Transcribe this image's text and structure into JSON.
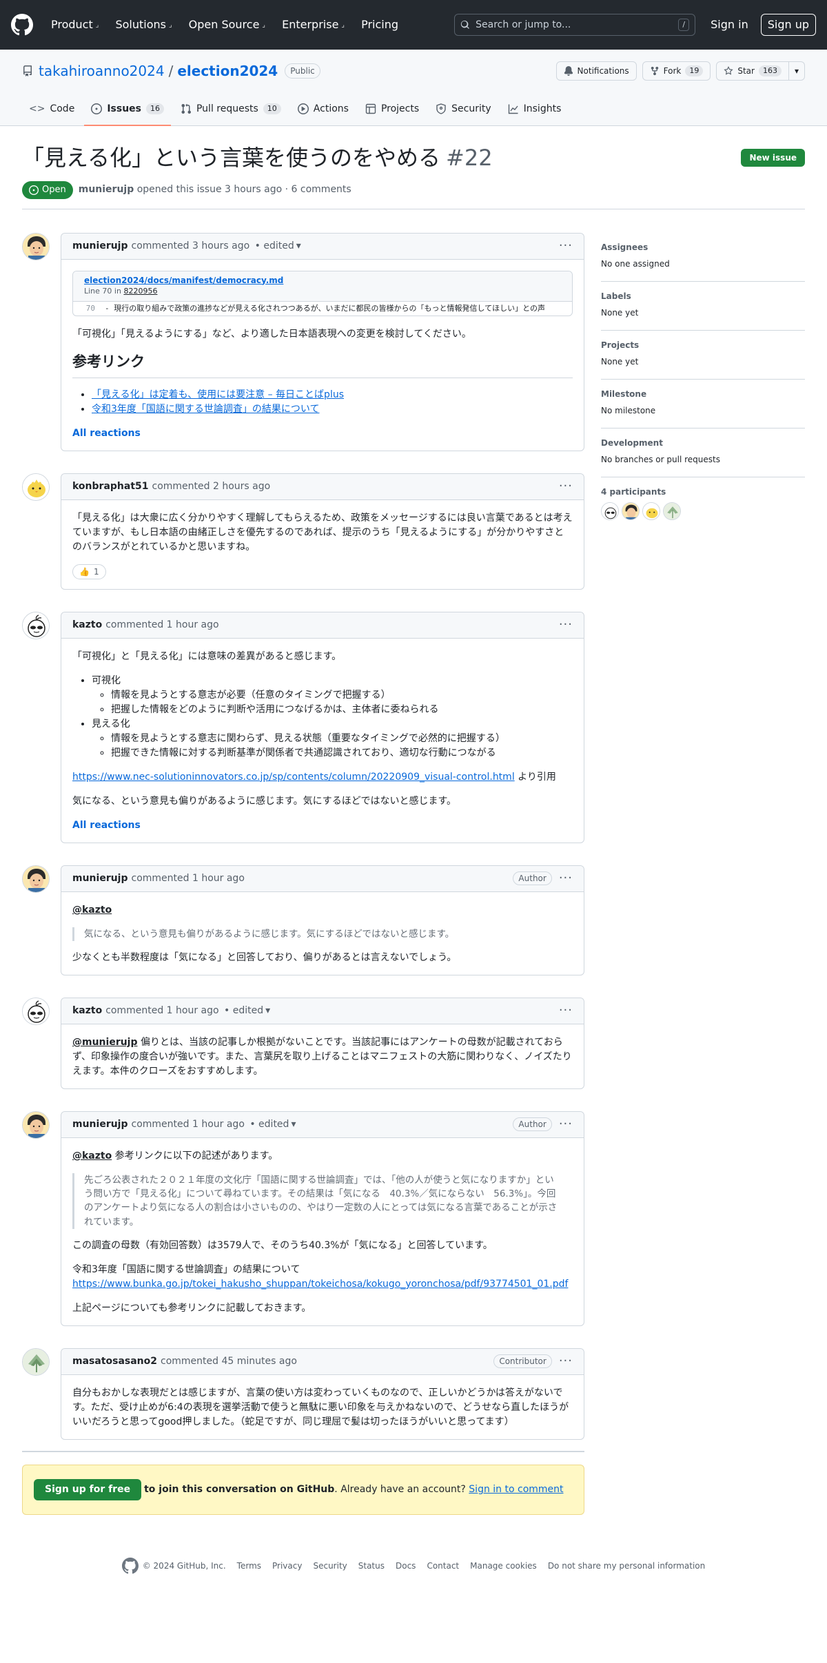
{
  "header": {
    "nav": [
      "Product",
      "Solutions",
      "Open Source",
      "Enterprise",
      "Pricing"
    ],
    "search_placeholder": "Search or jump to...",
    "search_kbd": "/",
    "signin": "Sign in",
    "signup": "Sign up"
  },
  "repo": {
    "owner": "takahiroanno2024",
    "name": "election2024",
    "visibility": "Public",
    "notifications": "Notifications",
    "fork_label": "Fork",
    "fork_count": "19",
    "star_label": "Star",
    "star_count": "163",
    "tabs": [
      {
        "label": "Code",
        "count": ""
      },
      {
        "label": "Issues",
        "count": "16"
      },
      {
        "label": "Pull requests",
        "count": "10"
      },
      {
        "label": "Actions",
        "count": ""
      },
      {
        "label": "Projects",
        "count": ""
      },
      {
        "label": "Security",
        "count": ""
      },
      {
        "label": "Insights",
        "count": ""
      }
    ]
  },
  "issue": {
    "title": "「見える化」という言葉を使うのをやめる",
    "number": "#22",
    "new_issue": "New issue",
    "state": "Open",
    "author": "munierujp",
    "meta": "opened this issue 3 hours ago · 6 comments"
  },
  "comments": {
    "c1": {
      "author": "munierujp",
      "time": "commented 3 hours ago",
      "edited": "• edited",
      "permalink_file": "election2024/docs/manifest/democracy.md",
      "permalink_line": "Line 70 in",
      "permalink_commit": "8220956",
      "code_line_no": "70",
      "code_text": "- 現行の取り組みで政策の進捗などが見える化されつつあるが、いまだに都民の皆様からの「もっと情報発信してほしい」との声",
      "text": "「可視化」「見えるようにする」など、より適した日本語表現への変更を検討してください。",
      "heading": "参考リンク",
      "link1": "「見える化」は定着も、使用には要注意 – 毎日ことばplus",
      "link2": "令和3年度「国語に関する世論調査」の結果について",
      "reactions": "All reactions"
    },
    "c2": {
      "author": "konbraphat51",
      "time": "commented 2 hours ago",
      "text": "「見える化」は大衆に広く分かりやすく理解してもらえるため、政策をメッセージするには良い言葉であるとは考えていますが、もし日本語の由緒正しさを優先するのであれば、提示のうち「見えるようにする」が分かりやすさとのバランスがとれているかと思いますね。",
      "reaction_count": "1"
    },
    "c3": {
      "author": "kazto",
      "time": "commented 1 hour ago",
      "intro": "「可視化」と「見える化」には意味の差異があると感じます。",
      "item1": "可視化",
      "item1a": "情報を見ようとする意志が必要（任意のタイミングで把握する）",
      "item1b": "把握した情報をどのように判断や活用につなげるかは、主体者に委ねられる",
      "item2": "見える化",
      "item2a": "情報を見ようとする意志に関わらず、見える状態（重要なタイミングで必然的に把握する）",
      "item2b": "把握できた情報に対する判断基準が関係者で共通認識されており、適切な行動につながる",
      "link": "https://www.nec-solutioninnovators.co.jp/sp/contents/column/20220909_visual-control.html",
      "link_suffix": "より引用",
      "closing": "気になる、という意見も偏りがあるように感じます。気にするほどではないと感じます。",
      "reactions": "All reactions"
    },
    "c4": {
      "author": "munierujp",
      "time": "commented 1 hour ago",
      "role": "Author",
      "mention": "@kazto",
      "quote": "気になる、という意見も偏りがあるように感じます。気にするほどではないと感じます。",
      "text": "少なくとも半数程度は「気になる」と回答しており、偏りがあるとは言えないでしょう。"
    },
    "c5": {
      "author": "kazto",
      "time": "commented 1 hour ago",
      "edited": "• edited",
      "mention": "@munierujp",
      "text": "偏りとは、当該の記事しか根拠がないことです。当該記事にはアンケートの母数が記載されておらず、印象操作の度合いが強いです。また、言葉尻を取り上げることはマニフェストの大筋に関わりなく、ノイズたりえます。本件のクローズをおすすめします。"
    },
    "c6": {
      "author": "munierujp",
      "time": "commented 1 hour ago",
      "edited": "• edited",
      "role": "Author",
      "mention": "@kazto",
      "intro": "参考リンクに以下の記述があります。",
      "quote": "先ごろ公表された２０２１年度の文化庁「国語に関する世論調査」では、「他の人が使うと気になりますか」という問い方で「見える化」について尋ねています。その結果は「気になる　40.3%／気にならない　56.3%」。今回のアンケートより気になる人の割合は小さいものの、やはり一定数の人にとっては気になる言葉であることが示されています。",
      "text": "この調査の母数（有効回答数）は3579人で、そのうち40.3%が「気になる」と回答しています。",
      "ref_title": "令和3年度「国語に関する世論調査」の結果について",
      "ref_link": "https://www.bunka.go.jp/tokei_hakusho_shuppan/tokeichosa/kokugo_yoronchosa/pdf/93774501_01.pdf",
      "closing": "上記ページについても参考リンクに記載しておきます。"
    },
    "c7": {
      "author": "masatosasano2",
      "time": "commented 45 minutes ago",
      "role": "Contributor",
      "text": "自分もおかしな表現だとは感じますが、言葉の使い方は変わっていくものなので、正しいかどうかは答えがないです。ただ、受け止めが6:4の表現を選挙活動で使うと無駄に悪い印象を与えかねないので、どうせなら直したほうがいいだろうと思ってgood押しました。（蛇足ですが、同じ理屈で髪は切ったほうがいいと思ってます）"
    }
  },
  "join": {
    "signup": "Sign up for free",
    "text1": "to join this conversation on GitHub",
    "text2": ". Already have an account?",
    "signin": "Sign in to comment"
  },
  "sidebar": {
    "assignees_title": "Assignees",
    "assignees_value": "No one assigned",
    "labels_title": "Labels",
    "labels_value": "None yet",
    "projects_title": "Projects",
    "projects_value": "None yet",
    "milestone_title": "Milestone",
    "milestone_value": "No milestone",
    "development_title": "Development",
    "development_value": "No branches or pull requests",
    "participants_title": "4 participants"
  },
  "footer": {
    "copyright": "© 2024 GitHub, Inc.",
    "links": [
      "Terms",
      "Privacy",
      "Security",
      "Status",
      "Docs",
      "Contact",
      "Manage cookies",
      "Do not share my personal information"
    ]
  },
  "colors": {
    "header_bg": "#24292f",
    "open_green": "#1f883d",
    "link_blue": "#0969da",
    "tab_underline": "#fd8c73"
  }
}
